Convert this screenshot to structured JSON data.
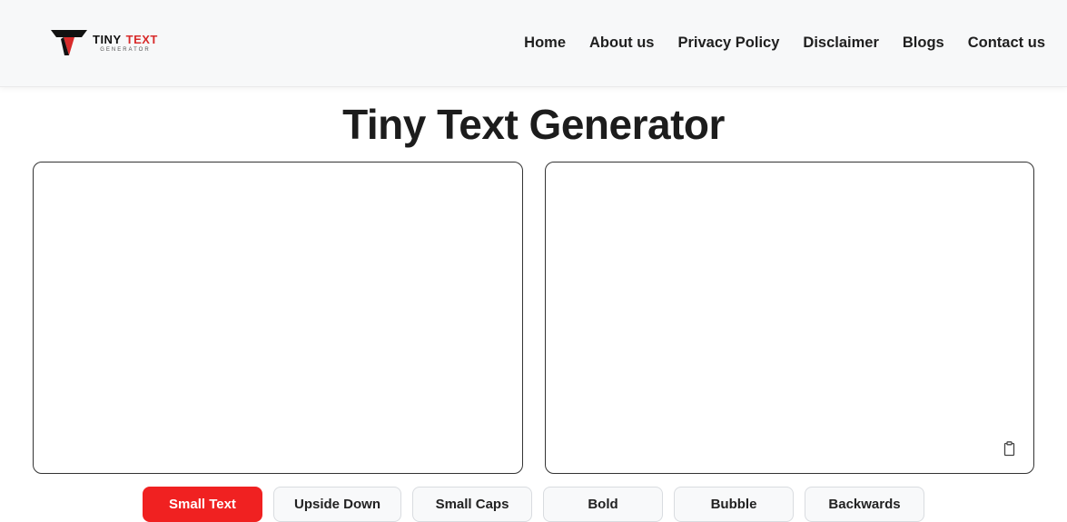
{
  "logo": {
    "word1": "TINY",
    "word2": "TEXT",
    "sub": "GENERATOR"
  },
  "nav": {
    "items": [
      {
        "label": "Home"
      },
      {
        "label": "About us"
      },
      {
        "label": "Privacy Policy"
      },
      {
        "label": "Disclaimer"
      },
      {
        "label": "Blogs"
      },
      {
        "label": "Contact us"
      }
    ]
  },
  "page_title": "Tiny Text Generator",
  "input": {
    "value": "",
    "placeholder": ""
  },
  "output": {
    "value": ""
  },
  "buttons": {
    "active_index": 0,
    "items": [
      {
        "label": "Small Text"
      },
      {
        "label": "Upside Down"
      },
      {
        "label": "Small Caps"
      },
      {
        "label": "Bold"
      },
      {
        "label": "Bubble"
      },
      {
        "label": "Backwards"
      }
    ]
  }
}
